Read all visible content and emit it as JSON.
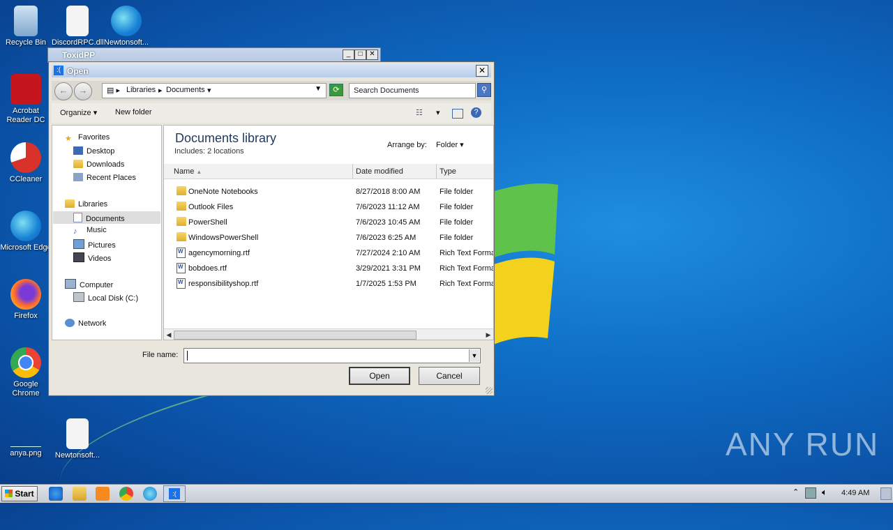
{
  "desktop": {
    "icons": [
      {
        "label": "Recycle Bin"
      },
      {
        "label": "DiscordRPC.dll"
      },
      {
        "label": "Newtonsoft..."
      },
      {
        "label": "Acrobat Reader DC"
      },
      {
        "label": "CCleaner"
      },
      {
        "label": "Microsoft Edge"
      },
      {
        "label": "Firefox"
      },
      {
        "label": "Google Chrome"
      },
      {
        "label": "anya.png"
      },
      {
        "label": "Newtonsoft..."
      }
    ],
    "watermark": "ANY RUN"
  },
  "back_window": {
    "title": "ToxidPP"
  },
  "dialog": {
    "title": "Open",
    "breadcrumb": [
      "Libraries",
      "Documents"
    ],
    "search_placeholder": "Search Documents",
    "toolbar": {
      "organize": "Organize",
      "new_folder": "New folder"
    },
    "nav": {
      "favorites": "Favorites",
      "desktop": "Desktop",
      "downloads": "Downloads",
      "recent": "Recent Places",
      "libraries": "Libraries",
      "documents": "Documents",
      "music": "Music",
      "pictures": "Pictures",
      "videos": "Videos",
      "computer": "Computer",
      "local_disk": "Local Disk (C:)",
      "network": "Network"
    },
    "library_title": "Documents library",
    "library_sub_label": "Includes:",
    "library_sub_value": "2 locations",
    "arrange_label": "Arrange by:",
    "arrange_value": "Folder",
    "columns": {
      "name": "Name",
      "date": "Date modified",
      "type": "Type"
    },
    "files": [
      {
        "name": "OneNote Notebooks",
        "date": "8/27/2018 8:00 AM",
        "type": "File folder",
        "kind": "folder"
      },
      {
        "name": "Outlook Files",
        "date": "7/6/2023 11:12 AM",
        "type": "File folder",
        "kind": "folder"
      },
      {
        "name": "PowerShell",
        "date": "7/6/2023 10:45 AM",
        "type": "File folder",
        "kind": "folder"
      },
      {
        "name": "WindowsPowerShell",
        "date": "7/6/2023 6:25 AM",
        "type": "File folder",
        "kind": "folder"
      },
      {
        "name": "agencymorning.rtf",
        "date": "7/27/2024 2:10 AM",
        "type": "Rich Text Forma",
        "kind": "rtf"
      },
      {
        "name": "bobdoes.rtf",
        "date": "3/29/2021 3:31 PM",
        "type": "Rich Text Forma",
        "kind": "rtf"
      },
      {
        "name": "responsibilityshop.rtf",
        "date": "1/7/2025 1:53 PM",
        "type": "Rich Text Forma",
        "kind": "rtf"
      }
    ],
    "file_name_label": "File name:",
    "file_name_value": "",
    "open_button": "Open",
    "cancel_button": "Cancel"
  },
  "taskbar": {
    "start": "Start",
    "clock": "4:49 AM"
  }
}
